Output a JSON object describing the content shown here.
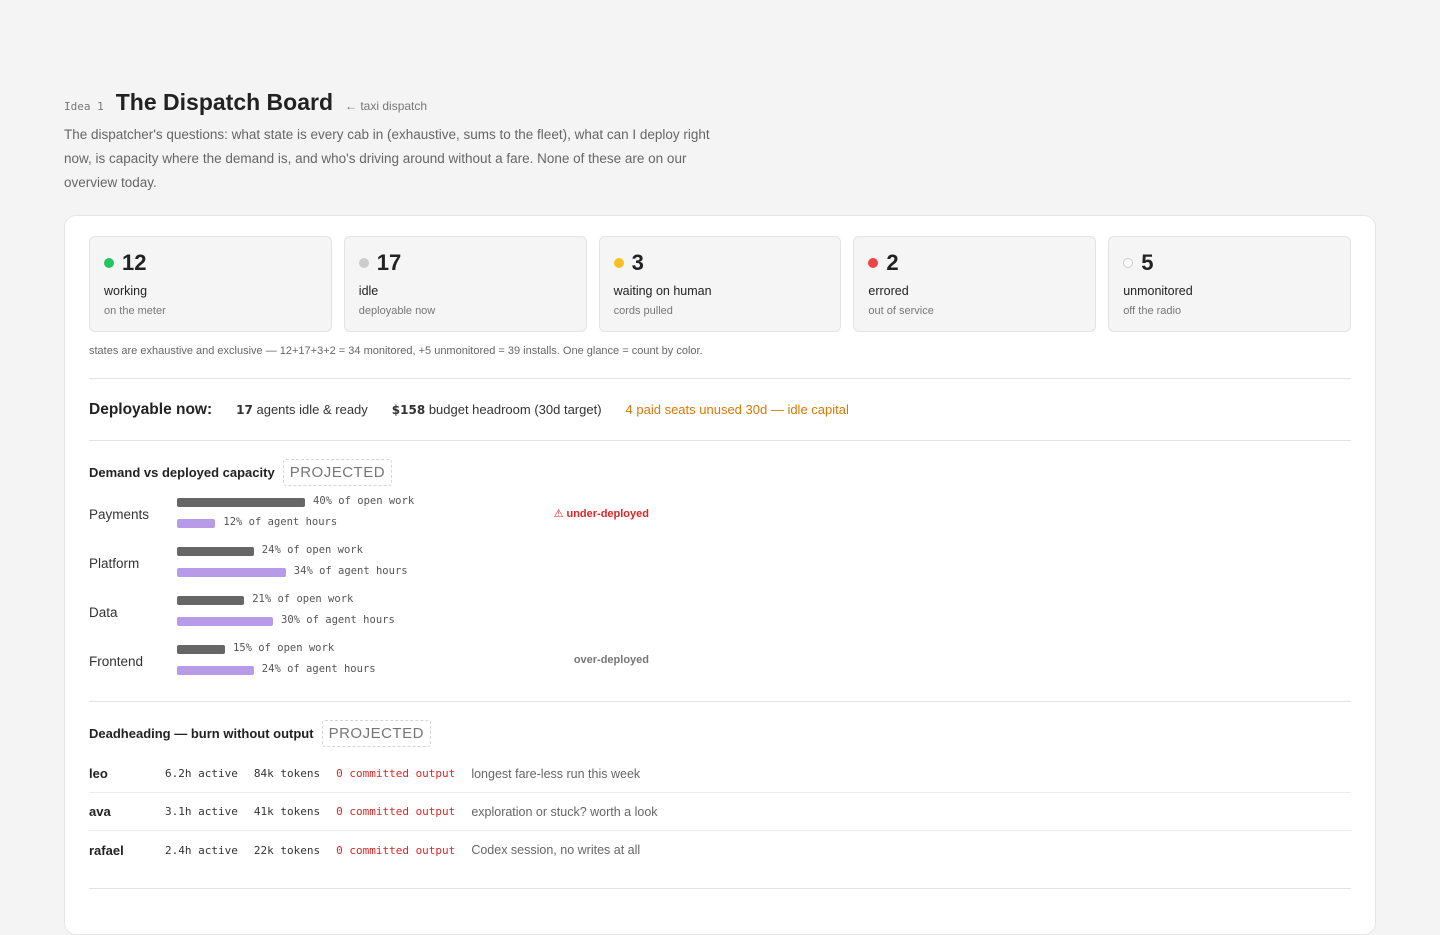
{
  "header": {
    "idea_label": "Idea 1",
    "title": "The Dispatch Board",
    "ref": "← taxi dispatch",
    "description": "The dispatcher's questions: what state is every cab in (exhaustive, sums to the fleet), what can I deploy right now, is capacity where the demand is, and who's driving around without a fare. None of these are on our overview today."
  },
  "states": [
    {
      "count": "12",
      "label": "working",
      "sub": "on the meter",
      "color": "#22c55e"
    },
    {
      "count": "17",
      "label": "idle",
      "sub": "deployable now",
      "color": "#cccccc"
    },
    {
      "count": "3",
      "label": "waiting on human",
      "sub": "cords pulled",
      "color": "#fbbf24"
    },
    {
      "count": "2",
      "label": "errored",
      "sub": "out of service",
      "color": "#ef4444"
    },
    {
      "count": "5",
      "label": "unmonitored",
      "sub": "off the radio",
      "color": "hollow"
    }
  ],
  "states_note": "states are exhaustive and exclusive — 12+17+3+2 = 34 monitored, +5 unmonitored = 39 installs. One glance = count by color.",
  "deployable": {
    "title": "Deployable now:",
    "items": [
      {
        "value": "17",
        "text": "agents idle & ready"
      },
      {
        "value": "$158",
        "text": "budget headroom (30d target)"
      }
    ],
    "warning": "4 paid seats unused 30d — idle capital"
  },
  "demand": {
    "title": "Demand vs deployed capacity",
    "badge": "PROJECTED",
    "rows": [
      {
        "team": "Payments",
        "work_pct": 40,
        "work_label": "40% of open work",
        "hours_pct": 12,
        "hours_label": "12% of agent hours",
        "flag": "⚠ under-deployed",
        "flag_color": "#dc2626"
      },
      {
        "team": "Platform",
        "work_pct": 24,
        "work_label": "24% of open work",
        "hours_pct": 34,
        "hours_label": "34% of agent hours",
        "flag": "",
        "flag_color": ""
      },
      {
        "team": "Data",
        "work_pct": 21,
        "work_label": "21% of open work",
        "hours_pct": 30,
        "hours_label": "30% of agent hours",
        "flag": "",
        "flag_color": ""
      },
      {
        "team": "Frontend",
        "work_pct": 15,
        "work_label": "15% of open work",
        "hours_pct": 24,
        "hours_label": "24% of agent hours",
        "flag": "over-deployed",
        "flag_color": "#777777"
      }
    ]
  },
  "deadheading": {
    "title": "Deadheading — burn without output",
    "badge": "PROJECTED",
    "rows": [
      {
        "name": "leo",
        "active": "6.2h active",
        "tokens": "84k tokens",
        "output": "0 committed output",
        "note": "longest fare-less run this week"
      },
      {
        "name": "ava",
        "active": "3.1h active",
        "tokens": "41k tokens",
        "output": "0 committed output",
        "note": "exploration or stuck? worth a look"
      },
      {
        "name": "rafael",
        "active": "2.4h active",
        "tokens": "22k tokens",
        "output": "0 committed output",
        "note": "Codex session, no writes at all"
      }
    ]
  }
}
